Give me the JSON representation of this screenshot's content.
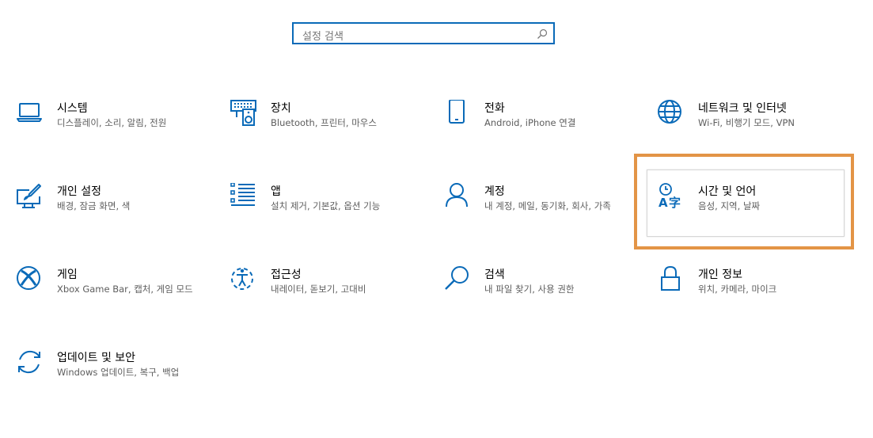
{
  "search": {
    "placeholder": "설정 검색"
  },
  "accent_color": "#0a6ab8",
  "highlight_color": "#e39446",
  "tiles": [
    {
      "icon": "laptop-icon",
      "title": "시스템",
      "desc": "디스플레이, 소리, 알림, 전원"
    },
    {
      "icon": "devices-icon",
      "title": "장치",
      "desc": "Bluetooth, 프린터, 마우스"
    },
    {
      "icon": "phone-icon",
      "title": "전화",
      "desc": "Android, iPhone 연결"
    },
    {
      "icon": "globe-icon",
      "title": "네트워크 및 인터넷",
      "desc": "Wi-Fi, 비행기 모드, VPN"
    },
    {
      "icon": "personalization-icon",
      "title": "개인 설정",
      "desc": "배경, 잠금 화면, 색"
    },
    {
      "icon": "apps-list-icon",
      "title": "앱",
      "desc": "설치 제거, 기본값, 옵션 기능"
    },
    {
      "icon": "person-icon",
      "title": "계정",
      "desc": "내 계정, 메일, 동기화, 회사, 가족"
    },
    {
      "icon": "time-language-icon",
      "title": "시간 및 언어",
      "desc": "음성, 지역, 날짜"
    },
    {
      "icon": "xbox-icon",
      "title": "게임",
      "desc": "Xbox Game Bar, 캡처, 게임 모드"
    },
    {
      "icon": "ease-of-access-icon",
      "title": "접근성",
      "desc": "내레이터, 돋보기, 고대비"
    },
    {
      "icon": "search-icon",
      "title": "검색",
      "desc": "내 파일 찾기, 사용 권한"
    },
    {
      "icon": "lock-icon",
      "title": "개인 정보",
      "desc": "위치, 카메라, 마이크"
    },
    {
      "icon": "update-icon",
      "title": "업데이트 및 보안",
      "desc": "Windows 업데이트, 복구, 백업"
    }
  ]
}
